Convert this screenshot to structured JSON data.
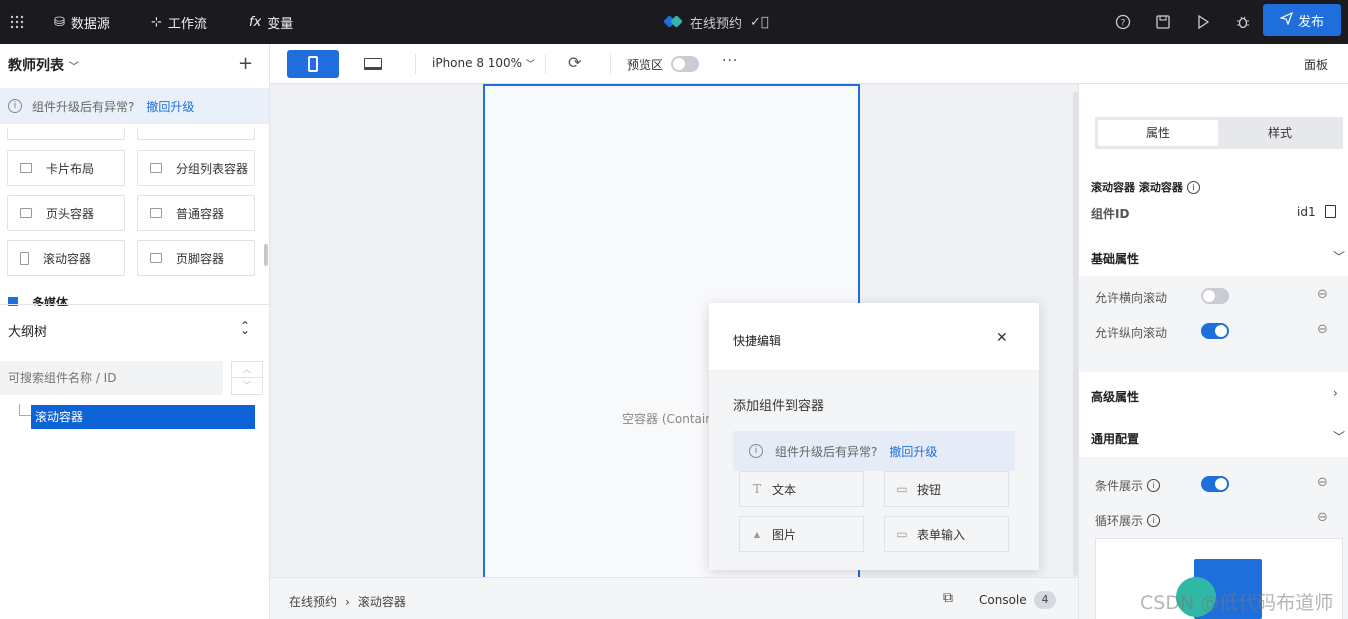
{
  "topbar": {
    "datasource": "数据源",
    "workflow": "工作流",
    "variables": "变量",
    "app_title": "在线预约",
    "publish": "发布"
  },
  "left": {
    "title": "教师列表",
    "notice_text": "组件升级后有异常?",
    "notice_link": "撤回升级",
    "components": [
      "卡片布局",
      "分组列表容器",
      "页头容器",
      "普通容器",
      "滚动容器",
      "页脚容器"
    ],
    "group_partial": "多媒体",
    "outline_title": "大纲树",
    "search_placeholder": "可搜索组件名称 / ID",
    "tree_node": "滚动容器"
  },
  "toolbar": {
    "device": "iPhone 8 100%",
    "preview_label": "预览区",
    "preview_on": false,
    "panel_label": "面板"
  },
  "canvas": {
    "placeholder": "空容器 (Containe"
  },
  "popover": {
    "title": "快捷编辑",
    "subtitle": "添加组件到容器",
    "notice_text": "组件升级后有异常?",
    "notice_link": "撤回升级",
    "items": [
      "文本",
      "按钮",
      "图片",
      "表单输入"
    ]
  },
  "statusbar": {
    "crumbs": [
      "在线预约",
      "滚动容器"
    ],
    "console_label": "Console",
    "console_count": "4"
  },
  "right": {
    "tabs": [
      "属性",
      "样式"
    ],
    "active_tab": "属性",
    "component_name": "滚动容器 滚动容器",
    "id_label": "组件ID",
    "id_value": "id1",
    "basic_title": "基础属性",
    "allow_h_scroll": "允许横向滚动",
    "allow_h_scroll_on": false,
    "allow_v_scroll": "允许纵向滚动",
    "allow_v_scroll_on": true,
    "advanced_title": "高级属性",
    "general_title": "通用配置",
    "conditional_display": "条件展示",
    "conditional_display_on": true,
    "loop_display": "循环展示"
  },
  "watermark": "CSDN @低代码布道师",
  "colors": {
    "accent": "#1e6fdc",
    "topbar_bg": "#1b1b1f"
  }
}
